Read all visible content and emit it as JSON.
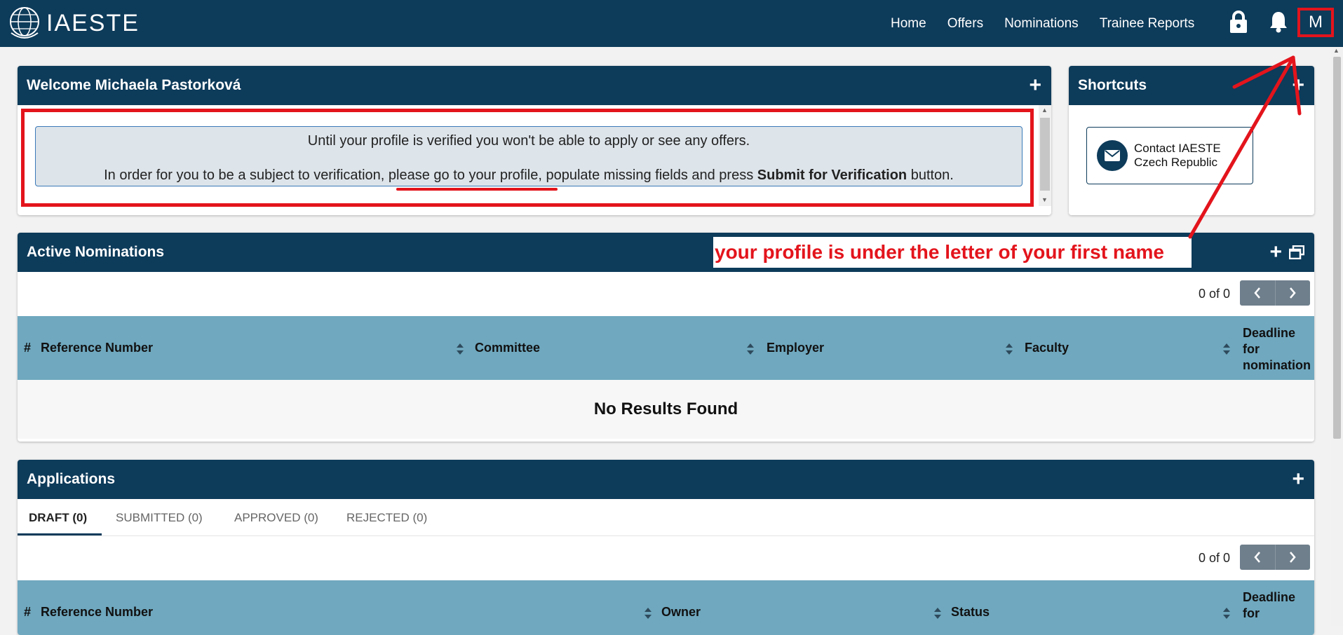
{
  "navbar": {
    "brand": "IAESTE",
    "links": [
      "Home",
      "Offers",
      "Nominations",
      "Trainee Reports"
    ],
    "avatar_letter": "M"
  },
  "welcome": {
    "title": "Welcome Michaela Pastorková",
    "line1": "Until your profile is verified you won't be able to apply or see any offers.",
    "line2_prefix": "In order for you to be a subject to verification, ",
    "line2_link": "please go to your profile",
    "line2_middle": ", populate missing fields and press ",
    "line2_bold": "Submit for Verification",
    "line2_suffix": " button."
  },
  "shortcuts": {
    "title": "Shortcuts",
    "contact_line1": "Contact IAESTE",
    "contact_line2": "Czech Republic"
  },
  "annotation": {
    "text": "your profile is under the letter of your first name",
    "color": "#e3141c"
  },
  "nominations": {
    "title": "Active Nominations",
    "pager_text": "0 of 0",
    "columns": [
      "#",
      "Reference Number",
      "Committee",
      "Employer",
      "Faculty"
    ],
    "deadline_col": [
      "Deadline",
      "for",
      "nomination"
    ],
    "empty_text": "No Results Found"
  },
  "applications": {
    "title": "Applications",
    "tabs": [
      "DRAFT (0)",
      "SUBMITTED (0)",
      "APPROVED (0)",
      "REJECTED (0)"
    ],
    "pager_text": "0 of 0",
    "columns": [
      "#",
      "Reference Number",
      "Owner",
      "Status"
    ],
    "deadline_col": [
      "Deadline",
      "for"
    ]
  },
  "colors": {
    "navy": "#0d3b5a",
    "table_header": "#6fa8bf",
    "alert_bg": "#dde4ea"
  }
}
